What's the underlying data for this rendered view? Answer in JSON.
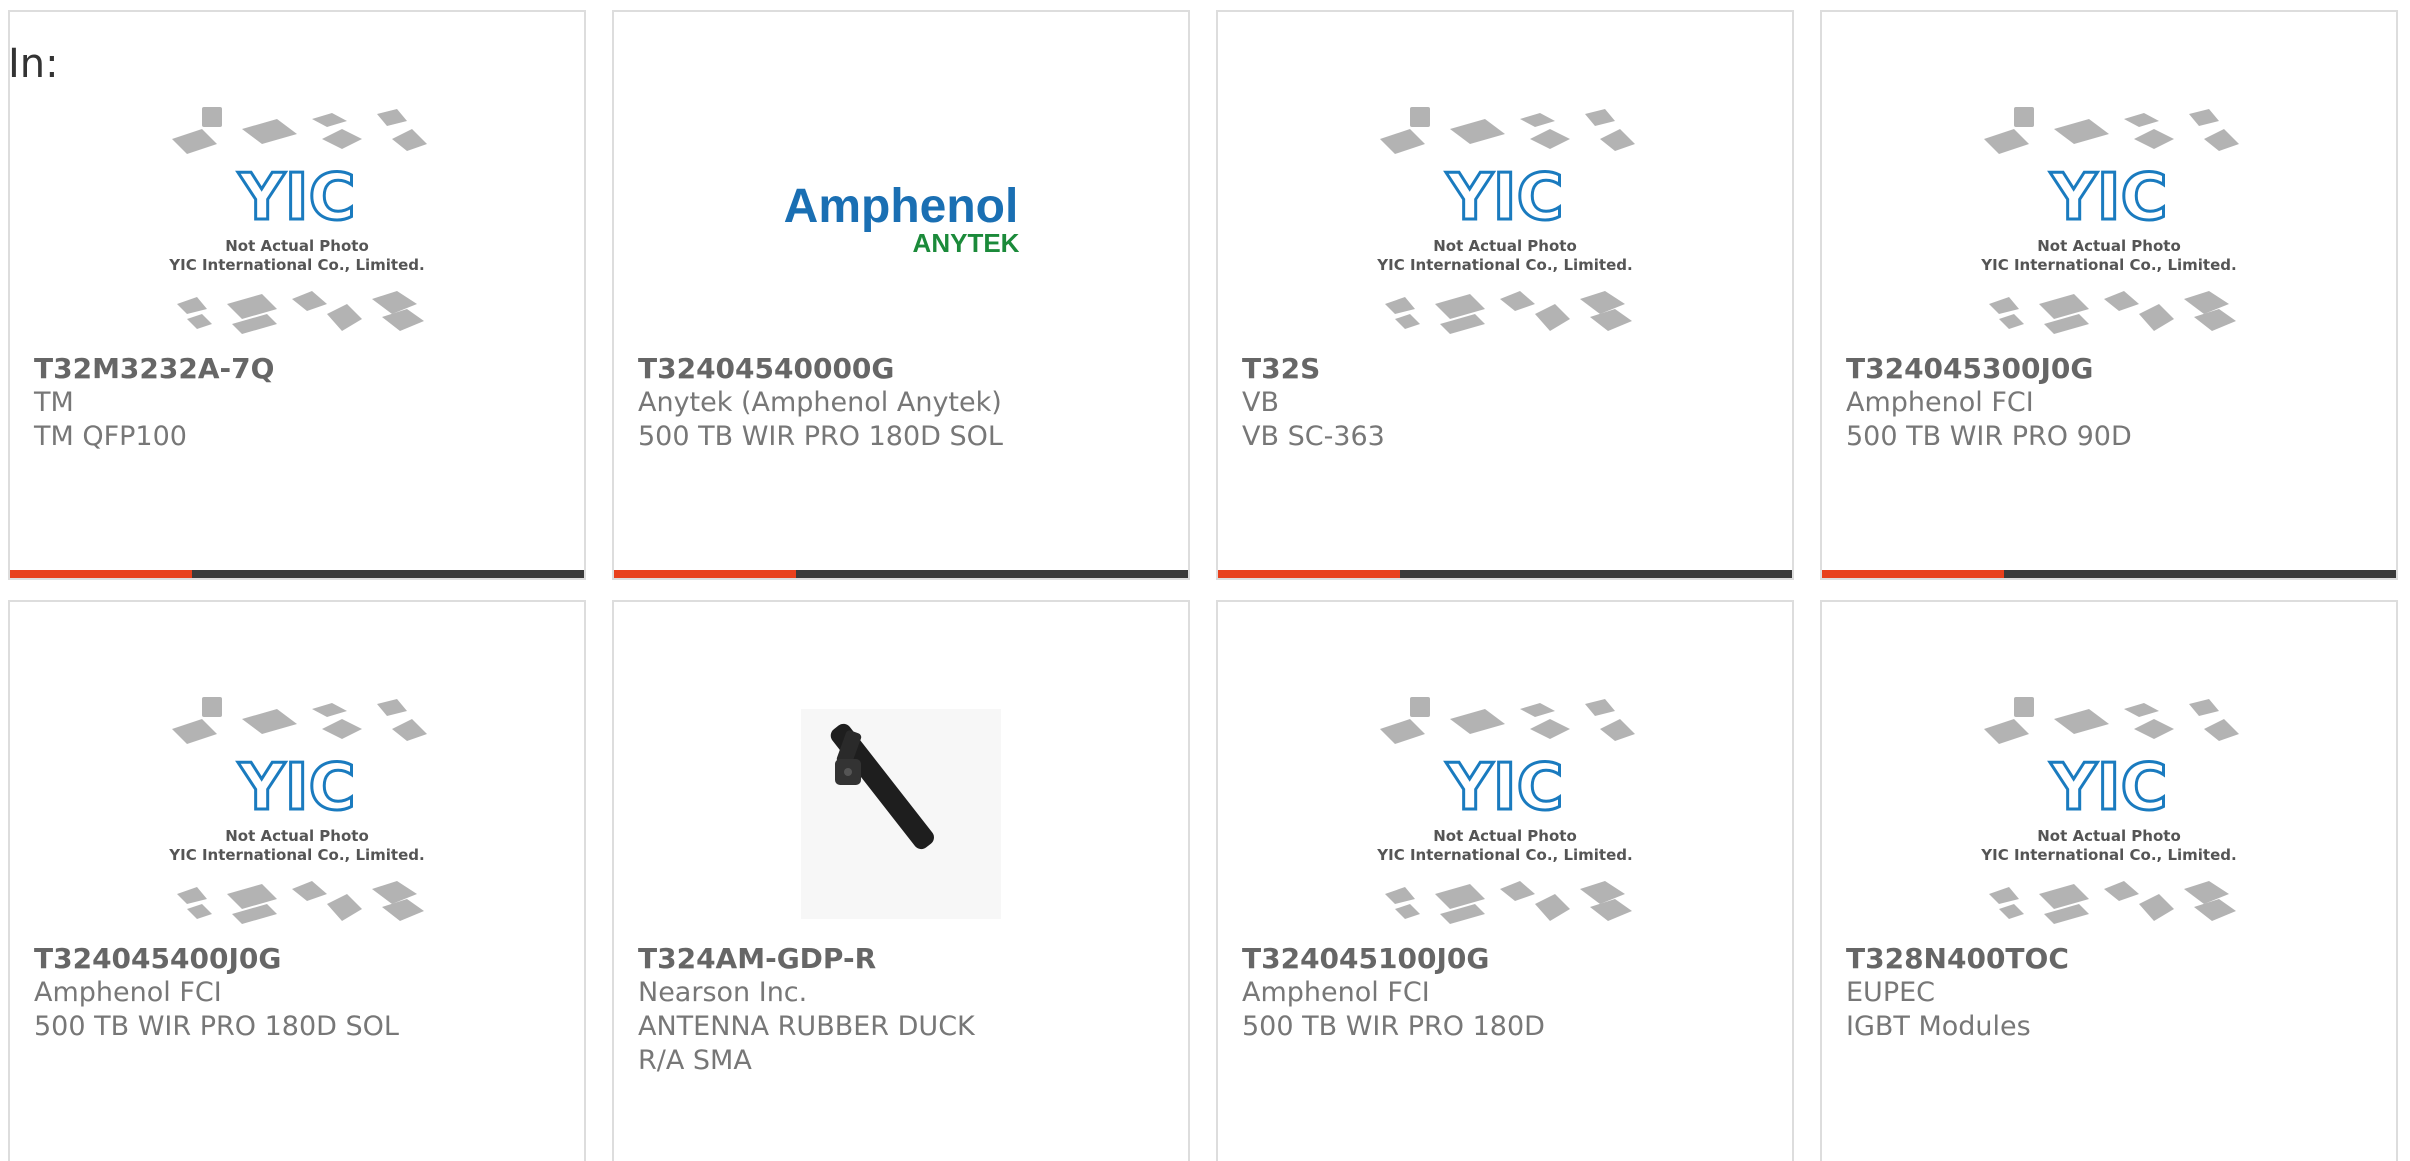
{
  "header": {
    "in_label": "In:"
  },
  "colors": {
    "accent": "#e8401c",
    "bar_dark": "#3a3a3a",
    "yic_blue": "#1a7bbf",
    "amphenol_blue": "#1a6fb3",
    "anytek_green": "#1b8a3a"
  },
  "placeholder": {
    "icon": "yic-not-actual-photo-icon",
    "line1": "Not Actual Photo",
    "line2": "YIC International Co., Limited.",
    "logo_text": "YIC"
  },
  "amphenol_logo": {
    "icon": "amphenol-anytek-logo",
    "brand": "Amphenol",
    "sub": "ANYTEK"
  },
  "antenna_photo": {
    "icon": "rubber-duck-antenna-image"
  },
  "products": [
    {
      "part_number": "T32M3232A-7Q",
      "manufacturer": "TM",
      "description": "TM QFP100",
      "image": "placeholder"
    },
    {
      "part_number": "T32404540000G",
      "manufacturer": "Anytek (Amphenol Anytek)",
      "description": "500 TB WIR PRO 180D SOL",
      "image": "amphenol"
    },
    {
      "part_number": "T32S",
      "manufacturer": "VB",
      "description": "VB SC-363",
      "image": "placeholder"
    },
    {
      "part_number": "T324045300J0G",
      "manufacturer": "Amphenol FCI",
      "description": "500 TB WIR PRO 90D",
      "image": "placeholder"
    },
    {
      "part_number": "T324045400J0G",
      "manufacturer": "Amphenol FCI",
      "description": "500 TB WIR PRO 180D SOL",
      "image": "placeholder"
    },
    {
      "part_number": "T324AM-GDP-R",
      "manufacturer": "Nearson Inc.",
      "description": "ANTENNA RUBBER DUCK R/A SMA",
      "image": "antenna"
    },
    {
      "part_number": "T324045100J0G",
      "manufacturer": "Amphenol FCI",
      "description": "500 TB WIR PRO 180D",
      "image": "placeholder"
    },
    {
      "part_number": "T328N400TOC",
      "manufacturer": "EUPEC",
      "description": "IGBT Modules",
      "image": "placeholder"
    }
  ]
}
